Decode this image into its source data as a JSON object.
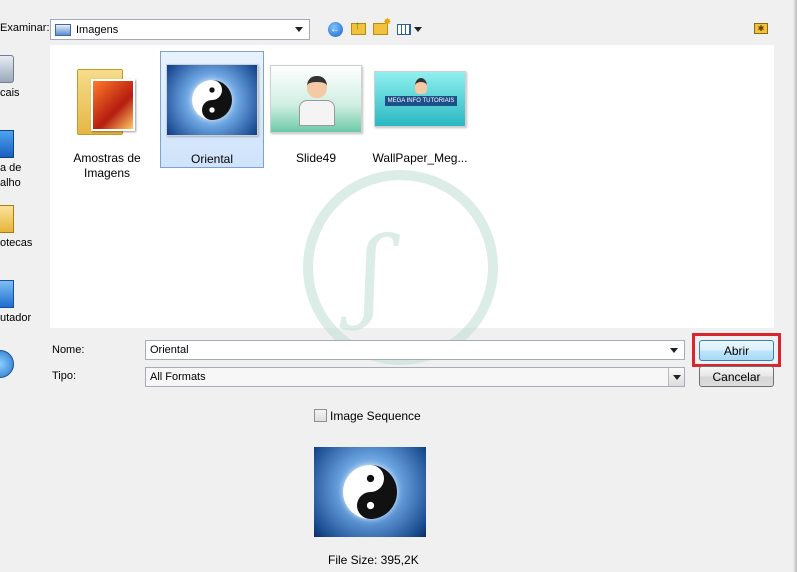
{
  "toolbar": {
    "lookin_label": "Examinar:",
    "lookin_value": "Imagens"
  },
  "places": [
    {
      "label": "cais"
    },
    {
      "label": "a de\nalho"
    },
    {
      "label": "otecas"
    },
    {
      "label": "utador"
    }
  ],
  "files": [
    {
      "name": "Amostras de\nImagens",
      "type": "folder"
    },
    {
      "name": "Oriental",
      "type": "image",
      "selected": true
    },
    {
      "name": "Slide49",
      "type": "image"
    },
    {
      "name": "WallPaper_Meg...",
      "type": "image"
    }
  ],
  "wallpaper_thumb_text": "MEGA INFO TUTORIAIS",
  "form": {
    "name_label": "Nome:",
    "name_value": "Oriental",
    "type_label": "Tipo:",
    "type_value": "All Formats"
  },
  "buttons": {
    "open": "Abrir",
    "cancel": "Cancelar"
  },
  "image_sequence_label": "Image Sequence",
  "file_size_text": "File Size: 395,2K",
  "colors": {
    "highlight": "#d9262e",
    "selection": "#cfe3fb"
  }
}
